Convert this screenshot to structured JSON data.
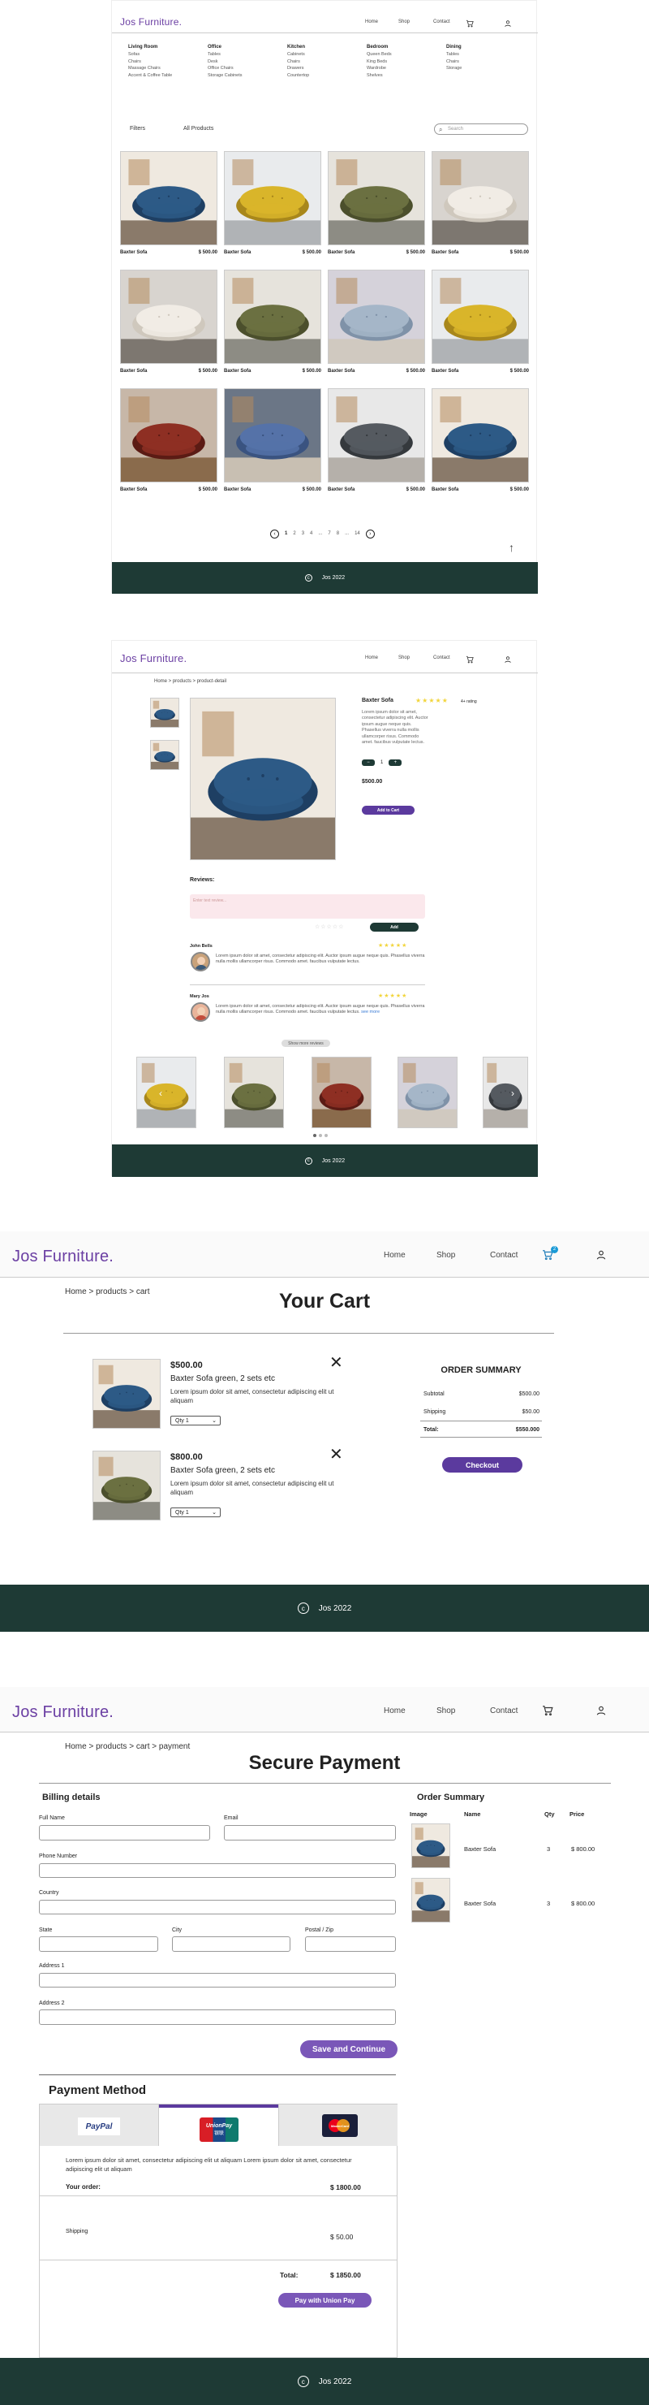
{
  "brand": "Jos Furniture.",
  "nav": {
    "home": "Home",
    "shop": "Shop",
    "contact": "Contact"
  },
  "cart_badge": "2",
  "footer_text": "Jos 2022",
  "icons": {
    "cart": "cart-icon",
    "user": "user-icon",
    "copyright": "copyright-icon",
    "search": "search-icon",
    "close": "close-icon",
    "arrow_up": "arrow-up-icon"
  },
  "colors": {
    "brand": "#6b3fa3",
    "footer": "#1e3a35",
    "button": "#5b3a9e",
    "star": "#f2d53c"
  },
  "shop": {
    "menu": [
      {
        "title": "Living Room",
        "items": [
          "Sofas",
          "Chairs",
          "Massage Chairs",
          "Accent & Coffee Table"
        ]
      },
      {
        "title": "Office",
        "items": [
          "Tables",
          "Desk",
          "Office Chairs",
          "Storage Cabinets"
        ]
      },
      {
        "title": "Kitchen",
        "items": [
          "Cabinets",
          "Chairs",
          "Drawers",
          "Countertop"
        ]
      },
      {
        "title": "Bedroom",
        "items": [
          "Queen Beds",
          "King Beds",
          "Wardrobe",
          "Shelves"
        ]
      },
      {
        "title": "Dining",
        "items": [
          "Tables",
          "Chairs",
          "Storage"
        ]
      }
    ],
    "filters_label": "Filters",
    "all_products_label": "All Products",
    "search_placeholder": "Search",
    "products": [
      {
        "name": "Baxter Sofa",
        "price": "$ 500.00",
        "img": "blue"
      },
      {
        "name": "Baxter Sofa",
        "price": "$ 500.00",
        "img": "yellow"
      },
      {
        "name": "Baxter Sofa",
        "price": "$ 500.00",
        "img": "green"
      },
      {
        "name": "Baxter Sofa",
        "price": "$ 500.00",
        "img": "white"
      },
      {
        "name": "Baxter Sofa",
        "price": "$ 500.00",
        "img": "white"
      },
      {
        "name": "Baxter Sofa",
        "price": "$ 500.00",
        "img": "green"
      },
      {
        "name": "Baxter Sofa",
        "price": "$ 500.00",
        "img": "tufted"
      },
      {
        "name": "Baxter Sofa",
        "price": "$ 500.00",
        "img": "yellow"
      },
      {
        "name": "Baxter Sofa",
        "price": "$ 500.00",
        "img": "leather"
      },
      {
        "name": "Baxter Sofa",
        "price": "$ 500.00",
        "img": "recliner"
      },
      {
        "name": "Baxter Sofa",
        "price": "$ 500.00",
        "img": "grey"
      },
      {
        "name": "Baxter Sofa",
        "price": "$ 500.00",
        "img": "blue"
      }
    ],
    "pages": [
      "1",
      "2",
      "3",
      "4",
      "...",
      "7",
      "8",
      "...",
      "14"
    ]
  },
  "detail": {
    "breadcrumb": "Home > products > product-detail",
    "title": "Baxter Sofa",
    "rating_text": "4+ rating",
    "description": "Lorem ipsum dolor sit amet, consectetur adipiscing elit. Auctor ipsum augue neque quis. Phasellus viverra nulla mollis ullamcorper risus. Commodo amet. faucibus vulputate lectus.",
    "qty": "1",
    "price": "$500.00",
    "add_to_cart": "Add to Cart",
    "reviews_title": "Reviews:",
    "review_placeholder": "Enter text review...",
    "review_button": "Add",
    "reviews": [
      {
        "name": "John Bells",
        "text": "Lorem ipsum dolor sit amet, consectetur adipiscing elit. Auctor ipsum augue neque quis. Phasellus viverra nulla mollis ullamcorper risus. Commodo amet. faucibus vulputate lectus."
      },
      {
        "name": "Mary Jos",
        "text": "Lorem ipsum dolor sit amet, consectetur adipiscing elit. Auctor ipsum augue neque quis. Phasellus viverra nulla mollis ullamcorper risus. Commodo amet. faucibus vulputate lectus.",
        "more": "see more"
      }
    ],
    "show_more": "Show more reviews"
  },
  "cart": {
    "breadcrumb": "Home > products > cart",
    "title": "Your Cart",
    "items": [
      {
        "price": "$500.00",
        "name": "Baxter Sofa green, 2 sets etc",
        "desc": "Lorem ipsum dolor sit amet, consectetur adipiscing elit ut aliquam",
        "qty": "Qty 1",
        "img": "blue"
      },
      {
        "price": "$800.00",
        "name": "Baxter Sofa green, 2 sets etc",
        "desc": "Lorem ipsum dolor sit amet, consectetur adipiscing elit ut aliquam",
        "qty": "Qty 1",
        "img": "green"
      }
    ],
    "summary_title": "ORDER SUMMARY",
    "subtotal_label": "Subtotal",
    "subtotal": "$500.00",
    "shipping_label": "Shipping",
    "shipping": "$50.00",
    "total_label": "Total:",
    "total": "$550.000",
    "checkout": "Checkout"
  },
  "payment": {
    "breadcrumb": "Home > products > cart > payment",
    "title": "Secure Payment",
    "billing_title": "Billing details",
    "fields": {
      "full_name": "Full Name",
      "email": "Email",
      "phone": "Phone Number",
      "country": "Country",
      "state": "State",
      "city": "City",
      "postal": "Postal / Zip",
      "address1": "Address 1",
      "address2": "Address 2"
    },
    "save": "Save and Continue",
    "method_title": "Payment Method",
    "methods": [
      "PayPal",
      "UnionPay",
      "MasterCard"
    ],
    "unionpay_cn": "银联",
    "method_desc": "Lorem ipsum dolor sit amet, consectetur adipiscing elit ut aliquam Lorem ipsum dolor sit amet, consectetur adipiscing elit ut aliquam",
    "order_label": "Your order:",
    "order_value": "$ 1800.00",
    "shipping_label": "Shipping",
    "shipping_value": "$ 50.00",
    "total_label": "Total:",
    "total_value": "$ 1850.00",
    "pay_button": "Pay with Union Pay",
    "summary_title": "Order Summary",
    "summary_headers": [
      "Image",
      "Name",
      "Qty",
      "Price"
    ],
    "summary_rows": [
      {
        "name": "Baxter Sofa",
        "qty": "3",
        "price": "$ 800.00",
        "img": "blue"
      },
      {
        "name": "Baxter Sofa",
        "qty": "3",
        "price": "$ 800.00",
        "img": "blue"
      }
    ]
  }
}
